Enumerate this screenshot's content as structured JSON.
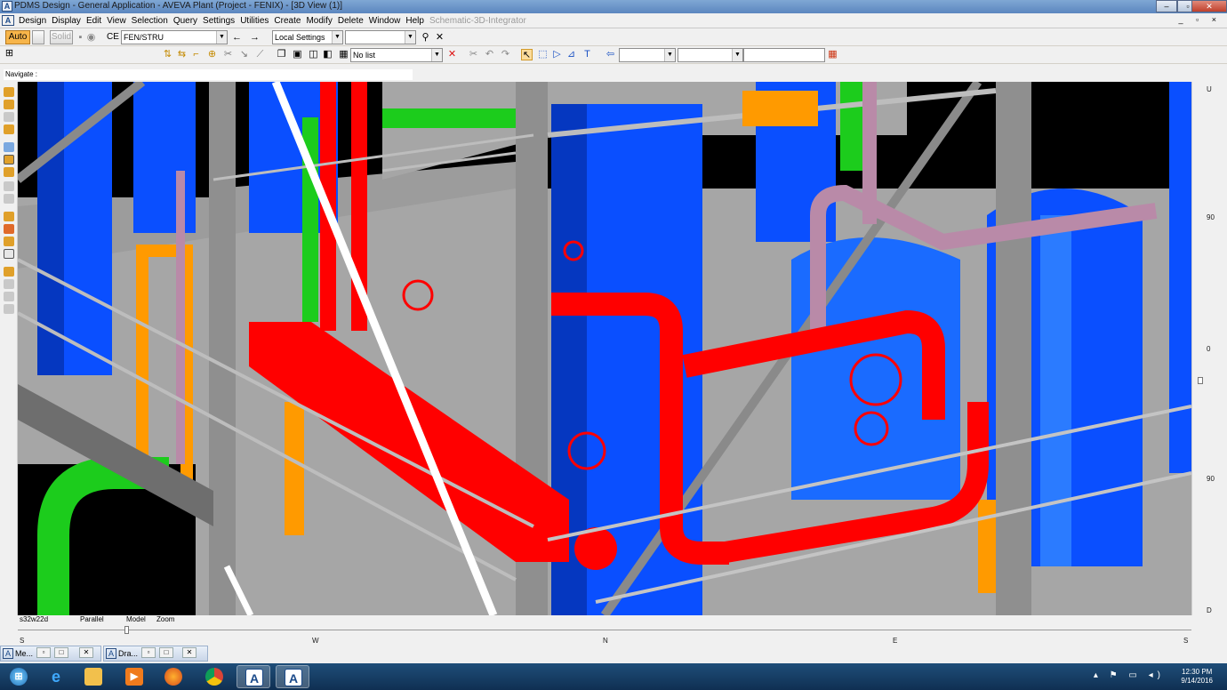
{
  "window": {
    "title": "PDMS Design - General Application - AVEVA Plant (Project - FENIX) - [3D View (1)]",
    "app_icon": "A",
    "minimize": "–",
    "restore": "▫",
    "close": "✕"
  },
  "menu": {
    "items": [
      "Design",
      "Display",
      "Edit",
      "View",
      "Selection",
      "Query",
      "Settings",
      "Utilities",
      "Create",
      "Modify",
      "Delete",
      "Window",
      "Help"
    ],
    "disabled_item": "Schematic-3D-Integrator",
    "mdi_controls": "_ ▫ ×"
  },
  "toolbar1": {
    "auto_label": "Auto",
    "solid_label": "Solid",
    "ce_label": "CE",
    "ce_value": "FEN/STRU",
    "settings_value": "Local Settings",
    "blank_value": ""
  },
  "toolbar2": {
    "list_value": "No list"
  },
  "navigate": {
    "label": "Navigate :"
  },
  "right_ruler": [
    "U",
    "90",
    "0",
    "90",
    "D"
  ],
  "status": {
    "view_name": "s32w22d",
    "projection": "Parallel",
    "mode": "Model",
    "action": "Zoom"
  },
  "compass": [
    "S",
    "W",
    "N",
    "E",
    "S"
  ],
  "mdi_windows": [
    {
      "label": "Me..."
    },
    {
      "label": "Dra..."
    }
  ],
  "taskbar": {
    "time": "12:30 PM",
    "date": "9/14/2016"
  },
  "colors": {
    "pipe_red": "#ff0000",
    "vessel_blue": "#0a4fff",
    "steel_grey": "#a6a6a6",
    "pipe_green": "#1ccc1c",
    "support_orange": "#ff9a00",
    "pipe_violet": "#b98aa8"
  }
}
